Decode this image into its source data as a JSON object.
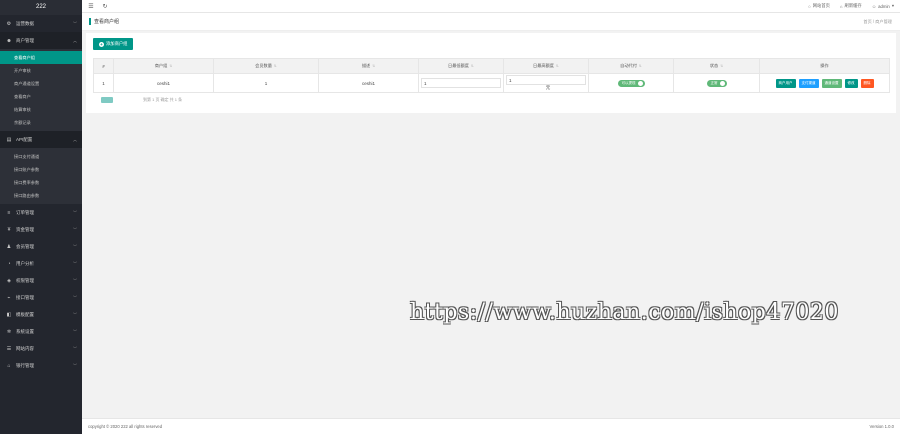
{
  "brand": "222",
  "sidebar": {
    "groups": [
      {
        "label": "运营数据",
        "icon": "gear-icon",
        "open": false
      },
      {
        "label": "商户管理",
        "icon": "user-icon",
        "open": true,
        "items": [
          "查看商户组",
          "开户审核",
          "商户通道设置",
          "查看商户",
          "结算审核",
          "余额记录"
        ]
      },
      {
        "label": "API配置",
        "icon": "api-icon",
        "open": true,
        "items": [
          "接口支付通道",
          "接口账户参数",
          "接口费率参数",
          "接口路由参数"
        ]
      },
      {
        "label": "订单管理",
        "icon": "list-icon",
        "open": false
      },
      {
        "label": "资金管理",
        "icon": "money-icon",
        "open": false
      },
      {
        "label": "会员管理",
        "icon": "member-icon",
        "open": false
      },
      {
        "label": "用户分析",
        "icon": "chart-icon",
        "open": false
      },
      {
        "label": "权限管理",
        "icon": "shield-icon",
        "open": false
      },
      {
        "label": "接口管理",
        "icon": "plug-icon",
        "open": false
      },
      {
        "label": "模板配置",
        "icon": "template-icon",
        "open": false
      },
      {
        "label": "系统设置",
        "icon": "settings-icon",
        "open": false
      },
      {
        "label": "网站内容",
        "icon": "content-icon",
        "open": false
      },
      {
        "label": "银行管理",
        "icon": "bank-icon",
        "open": false
      }
    ]
  },
  "topbar": {
    "items": [
      "网站首页",
      "刷新缓存",
      "admin"
    ]
  },
  "subhead": {
    "title": "查看商户组",
    "crumb": "首页 / 商户管理"
  },
  "panel": {
    "add_label": "添加商户组",
    "columns": [
      "#",
      "商户组",
      "会员数量",
      "描述",
      "日最低额度",
      "日最高额度",
      "自动代付",
      "状态",
      "操作"
    ],
    "row": {
      "index": "1",
      "group": "ceshi1",
      "members": "1",
      "desc": "ceshi1",
      "min": "1",
      "max": "1",
      "unit": "元",
      "auto": "可以提现",
      "status": "正常",
      "ops": [
        "商户用户",
        "支付渠道",
        "通道设置",
        "修改",
        "删除"
      ]
    },
    "pager_text": "到第 1 页 确定 共 1 条"
  },
  "footer": {
    "copyright": "copyright © 2020 222 all rights reserved",
    "version": "Version 1.0.0"
  },
  "watermark": "https://www.huzhan.com/ishop47020",
  "colors": {
    "primary": "#009688",
    "sidebar": "#23262e",
    "blue": "#1e9fff",
    "green": "#5fb878",
    "red": "#ff5722"
  }
}
